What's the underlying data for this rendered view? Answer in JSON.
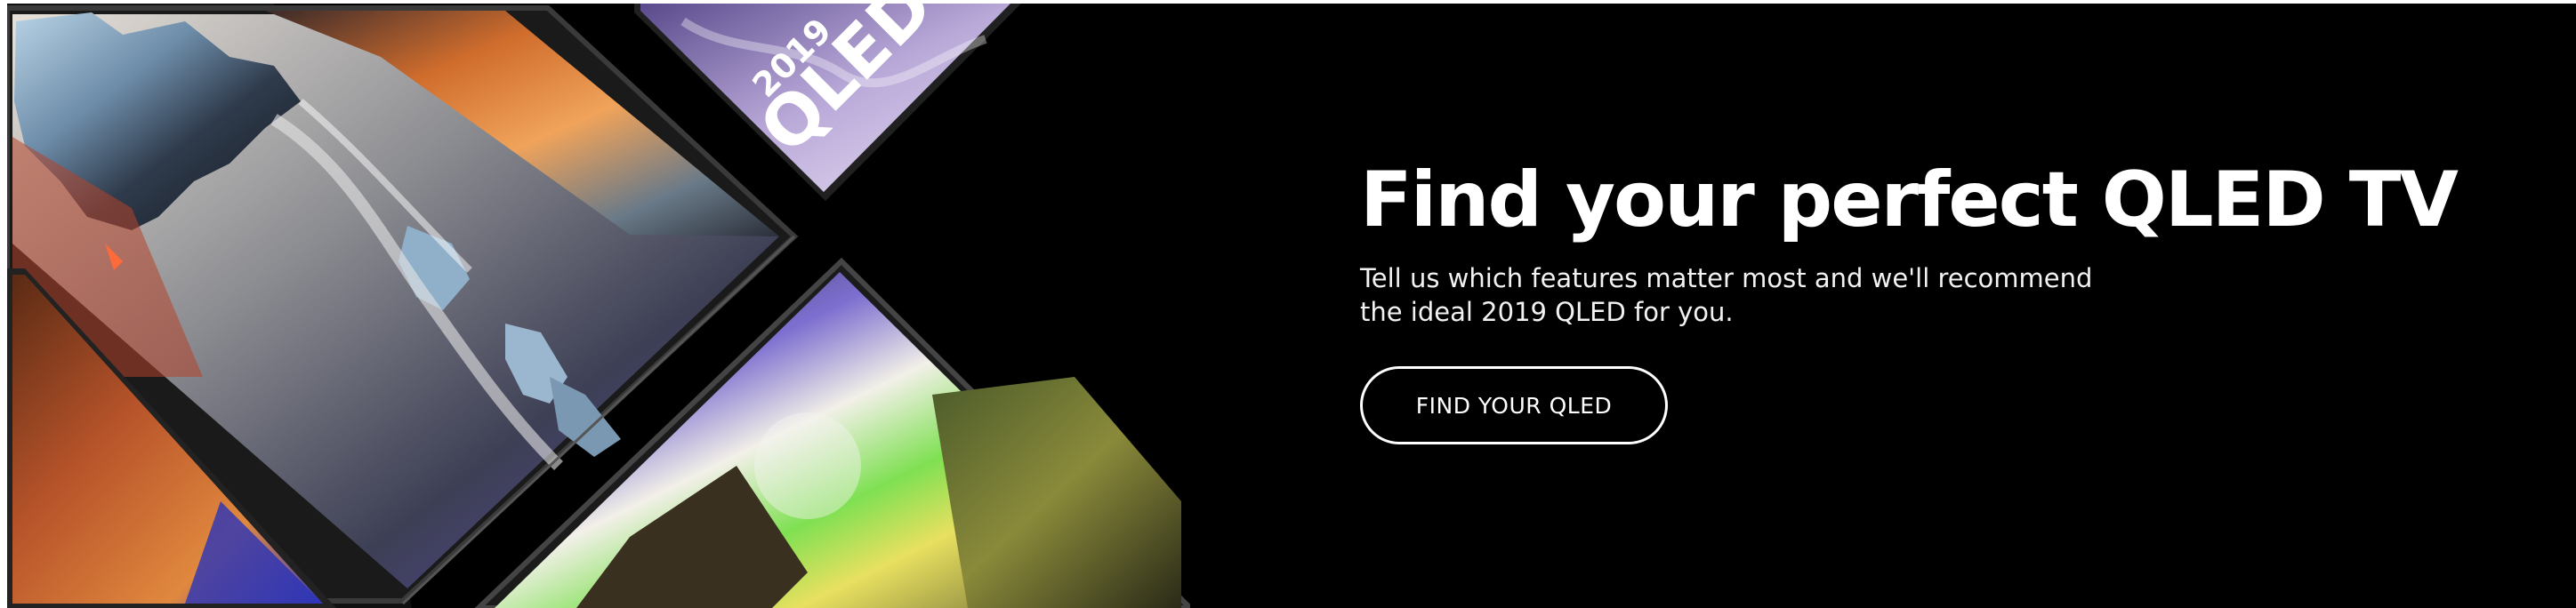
{
  "promo": {
    "headline": "Find your perfect QLED TV",
    "subhead": "Tell us which features matter most and we'll recommend the ideal 2019 QLED for you.",
    "cta_label": "FIND YOUR QLED"
  },
  "hero_image": {
    "badge_year": "2019",
    "badge_brand": "QLED"
  },
  "colors": {
    "background": "#000000",
    "text": "#ffffff",
    "button_border": "#ffffff"
  }
}
